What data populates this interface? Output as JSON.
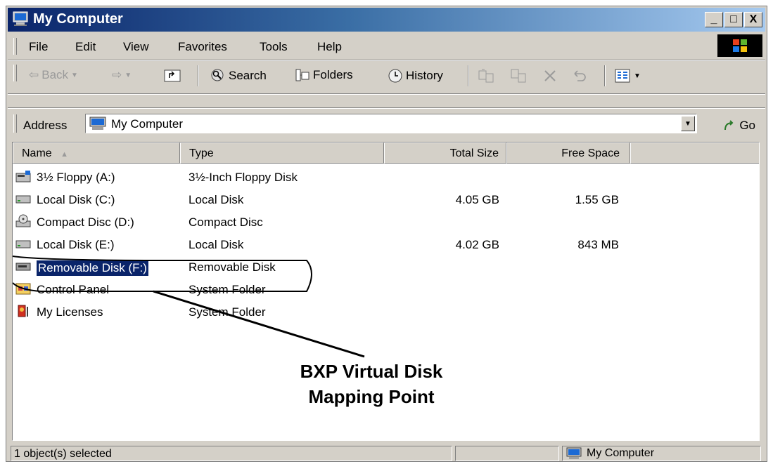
{
  "window": {
    "title": "My Computer"
  },
  "window_buttons": {
    "minimize": "_",
    "maximize": "□",
    "close": "X"
  },
  "menu": [
    "File",
    "Edit",
    "View",
    "Favorites",
    "Tools",
    "Help"
  ],
  "toolbar": {
    "back": "Back",
    "search": "Search",
    "folders": "Folders",
    "history": "History"
  },
  "address": {
    "label": "Address",
    "value": "My Computer",
    "go": "Go"
  },
  "columns": [
    "Name",
    "Type",
    "Total Size",
    "Free Space"
  ],
  "rows": [
    {
      "name": "3½ Floppy (A:)",
      "type": "3½-Inch Floppy Disk",
      "total": "",
      "free": "",
      "icon": "floppy-drive-icon"
    },
    {
      "name": "Local Disk (C:)",
      "type": "Local Disk",
      "total": "4.05 GB",
      "free": "1.55 GB",
      "icon": "hard-disk-icon"
    },
    {
      "name": "Compact Disc (D:)",
      "type": "Compact Disc",
      "total": "",
      "free": "",
      "icon": "cd-drive-icon"
    },
    {
      "name": "Local Disk (E:)",
      "type": "Local Disk",
      "total": "4.02 GB",
      "free": "843 MB",
      "icon": "hard-disk-icon"
    },
    {
      "name": "Removable Disk (F:)",
      "type": "Removable Disk",
      "total": "",
      "free": "",
      "icon": "removable-disk-icon",
      "selected": true
    },
    {
      "name": "Control Panel",
      "type": "System Folder",
      "total": "",
      "free": "",
      "icon": "control-panel-icon"
    },
    {
      "name": "My Licenses",
      "type": "System Folder",
      "total": "",
      "free": "",
      "icon": "licenses-icon"
    }
  ],
  "annotation": {
    "line1": "BXP Virtual Disk",
    "line2": "Mapping Point"
  },
  "status": {
    "left": "1 object(s) selected",
    "right": "My Computer"
  }
}
